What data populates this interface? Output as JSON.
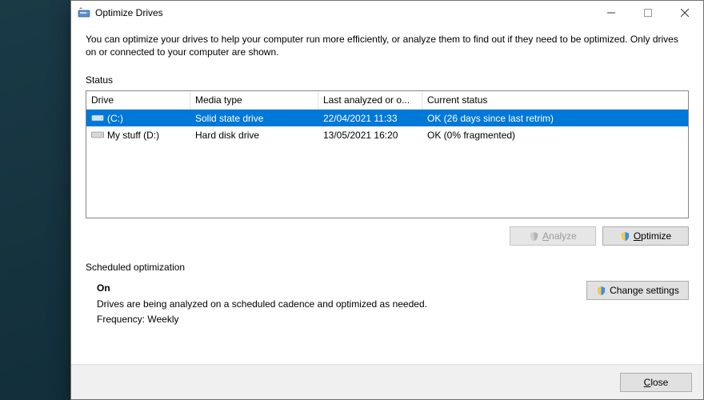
{
  "window": {
    "title": "Optimize Drives"
  },
  "intro": "You can optimize your drives to help your computer run more efficiently, or analyze them to find out if they need to be optimized. Only drives on or connected to your computer are shown.",
  "status_label": "Status",
  "table": {
    "headers": {
      "drive": "Drive",
      "media": "Media type",
      "last": "Last analyzed or o...",
      "status": "Current status"
    },
    "rows": [
      {
        "drive": "(C:)",
        "media": "Solid state drive",
        "last": "22/04/2021 11:33",
        "status": "OK (26 days since last retrim)",
        "selected": true,
        "icon": "ssd-drive-icon"
      },
      {
        "drive": "My stuff (D:)",
        "media": "Hard disk drive",
        "last": "13/05/2021 16:20",
        "status": "OK (0% fragmented)",
        "selected": false,
        "icon": "hdd-drive-icon"
      }
    ]
  },
  "buttons": {
    "analyze": "Analyze",
    "optimize": "Optimize",
    "change_settings": "Change settings",
    "close": "Close"
  },
  "scheduled": {
    "label": "Scheduled optimization",
    "on": "On",
    "description": "Drives are being analyzed on a scheduled cadence and optimized as needed.",
    "frequency_label": "Frequency:",
    "frequency_value": "Weekly"
  }
}
